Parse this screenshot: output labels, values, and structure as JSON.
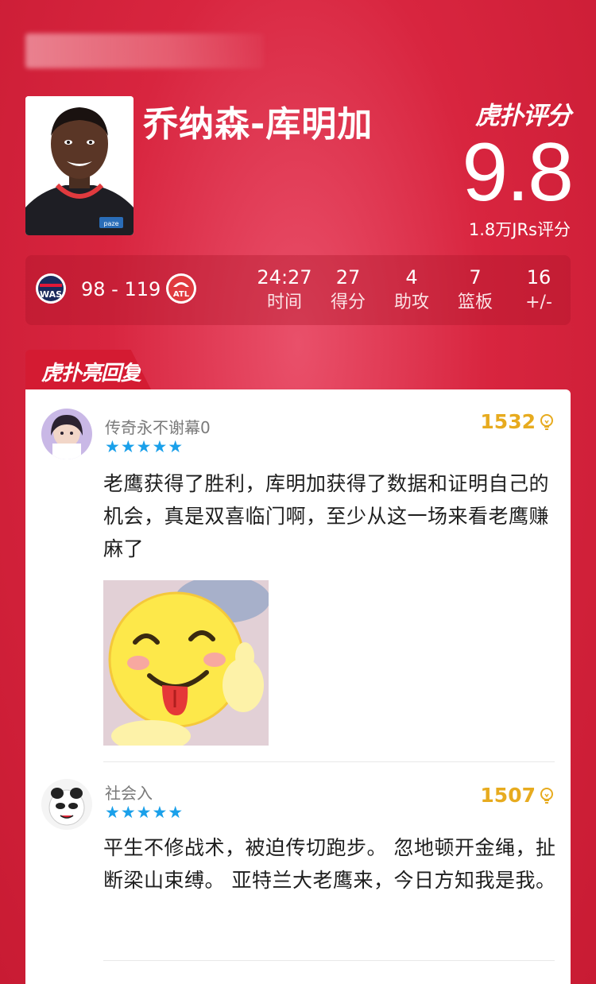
{
  "player": {
    "name": "乔纳森-库明加"
  },
  "rating": {
    "brand_label": "虎扑评分",
    "score": "9.8",
    "count_text": "1.8万JRs评分"
  },
  "game": {
    "home_team": "WAS",
    "away_team": "ATL",
    "score_text": "98 - 119",
    "stats": [
      {
        "value": "24:27",
        "label": "时间"
      },
      {
        "value": "27",
        "label": "得分"
      },
      {
        "value": "4",
        "label": "助攻"
      },
      {
        "value": "7",
        "label": "篮板"
      },
      {
        "value": "16",
        "label": "+/-"
      }
    ]
  },
  "section": {
    "title": "虎扑亮回复"
  },
  "comments": [
    {
      "user": "传奇永不谢幕0",
      "stars": "★★★★★",
      "rating_stars": 5,
      "likes": "1532",
      "text": "老鹰获得了胜利，库明加获得了数据和证明自己的机会，真是双喜临门啊，至少从这一场来看老鹰赚麻了"
    },
    {
      "user": "社会入",
      "stars": "★★★★★",
      "rating_stars": 5,
      "likes": "1507",
      "text": "平生不修战术，被迫传切跑步。 忽地顿开金绳，扯断梁山束缚。 亚特兰大老鹰来，今日方知我是我。"
    }
  ],
  "colors": {
    "background": "#d8253f",
    "accent_star": "#1aa0ea",
    "likes": "#e7ab1f"
  }
}
